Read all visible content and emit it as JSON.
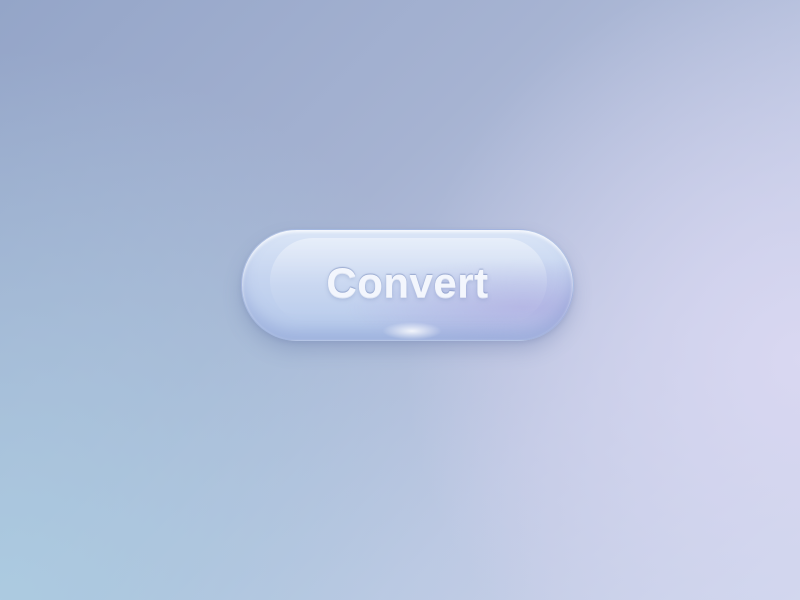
{
  "button": {
    "label": "Convert"
  },
  "colors": {
    "background_top_left": "#94a5c8",
    "background_bottom_left": "#acd0e2",
    "background_right": "#dad8f2",
    "button_top": "#dbe6f7",
    "button_bottom": "#b4c8ea",
    "label_color": "#f3f6fd"
  }
}
